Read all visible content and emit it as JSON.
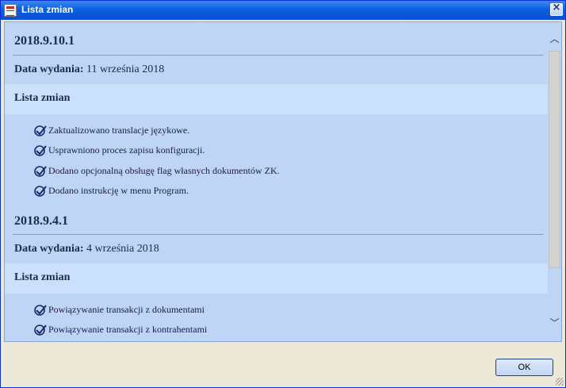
{
  "window": {
    "title": "Lista zmian"
  },
  "releases": [
    {
      "version": "2018.9.10.1",
      "date_label": "Data wydania:",
      "date": "11 września 2018",
      "section_label": "Lista zmian",
      "items": [
        "Zaktualizowano translacje językowe.",
        "Usprawniono proces zapisu konfiguracji.",
        "Dodano opcjonalną obsługę flag własnych dokumentów ZK.",
        "Dodano instrukcję w menu Program."
      ]
    },
    {
      "version": "2018.9.4.1",
      "date_label": "Data wydania:",
      "date": "4 września 2018",
      "section_label": "Lista zmian",
      "items": [
        "Powiązywanie transakcji z dokumentami",
        "Powiązywanie transakcji z kontrahentami"
      ]
    }
  ],
  "buttons": {
    "ok": "OK"
  },
  "colors": {
    "titlebar": "#0a5fe0",
    "content_bg": "#bed5f6",
    "band_bg": "#cbe0fb",
    "text": "#1a2d4a"
  },
  "icons": {
    "app": "app-icon",
    "close": "close-icon",
    "check": "check-icon",
    "scroll_up": "chevron-up-icon",
    "scroll_down": "chevron-down-icon"
  }
}
